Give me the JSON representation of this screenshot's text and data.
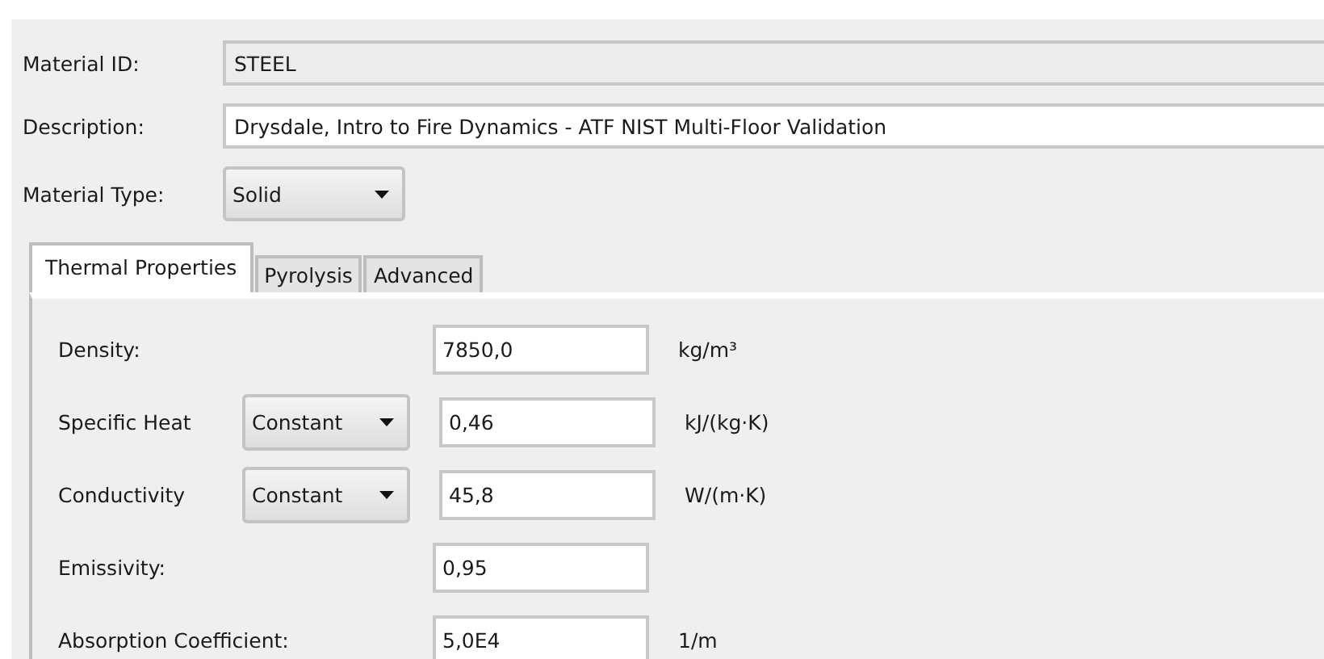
{
  "header_fields": [
    {
      "label": "Material ID:",
      "value": "STEEL",
      "disabled": true
    },
    {
      "label": "Description:",
      "value": "Drysdale, Intro to Fire Dynamics - ATF NIST Multi-Floor Validation",
      "disabled": false
    }
  ],
  "material_type": {
    "label": "Material Type:",
    "value": "Solid"
  },
  "tabs": [
    {
      "label": "Thermal Properties",
      "selected": true
    },
    {
      "label": "Pyrolysis",
      "selected": false
    },
    {
      "label": "Advanced",
      "selected": false
    }
  ],
  "properties": [
    {
      "kind": "plain",
      "label": "Density:",
      "value": "7850,0",
      "unit": "kg/m³"
    },
    {
      "kind": "combo",
      "label": "Specific Heat",
      "mode": "Constant",
      "value": "0,46",
      "unit": "kJ/(kg·K)"
    },
    {
      "kind": "combo",
      "label": "Conductivity",
      "mode": "Constant",
      "value": "45,8",
      "unit": "W/(m·K)"
    },
    {
      "kind": "plain",
      "label": "Emissivity:",
      "value": "0,95"
    },
    {
      "kind": "plain",
      "label": "Absorption Coefficient:",
      "value": "5,0E4",
      "unit": "1/m"
    }
  ]
}
